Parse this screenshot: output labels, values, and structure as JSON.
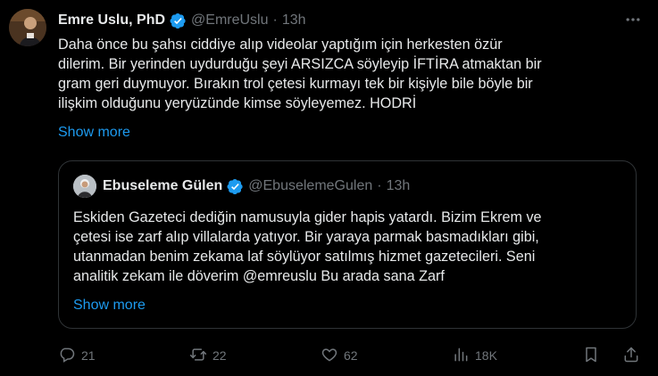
{
  "author": {
    "name": "Emre Uslu, PhD",
    "handle": "@EmreUslu",
    "separator": "·",
    "time": "13h"
  },
  "tweet": {
    "lines": [
      "Daha önce bu şahsı ciddiye alıp videolar yaptığım için herkesten özür",
      "dilerim. Bir yerinden uydurduğu şeyi ARSIZCA söyleyip İFTİRA atmaktan bir",
      "gram geri duymuyor. Bırakın trol çetesi kurmayı tek bir kişiyle bile böyle bir",
      "ilişkim olduğunu yeryüzünde kimse söyleyemez. HODRİ"
    ],
    "show_more": "Show more"
  },
  "quote": {
    "name": "Ebuseleme Gülen",
    "handle": "@EbuselemeGulen",
    "separator": "·",
    "time": "13h",
    "lines": [
      "Eskiden Gazeteci dediğin namusuyla gider hapis yatardı. Bizim Ekrem ve",
      "çetesi ise zarf alıp villalarda yatıyor. Bir yaraya parmak basmadıkları gibi,",
      "utanmadan benim zekama laf söylüyor satılmış hizmet gazetecileri. Seni",
      "analitik zekam ile döverim @emreuslu Bu arada sana Zarf"
    ],
    "show_more": "Show more"
  },
  "actions": {
    "replies": "21",
    "reposts": "22",
    "likes": "62",
    "views": "18K"
  },
  "icons": {
    "verified": "verified-badge-icon",
    "more": "more-icon",
    "reply": "reply-icon",
    "repost": "repost-icon",
    "like": "like-icon",
    "views": "views-icon",
    "bookmark": "bookmark-icon",
    "share": "share-icon"
  },
  "colors": {
    "background": "#000000",
    "text": "#e7e9ea",
    "secondary": "#71767b",
    "accent": "#1d9bf0",
    "border": "#2f3336"
  }
}
